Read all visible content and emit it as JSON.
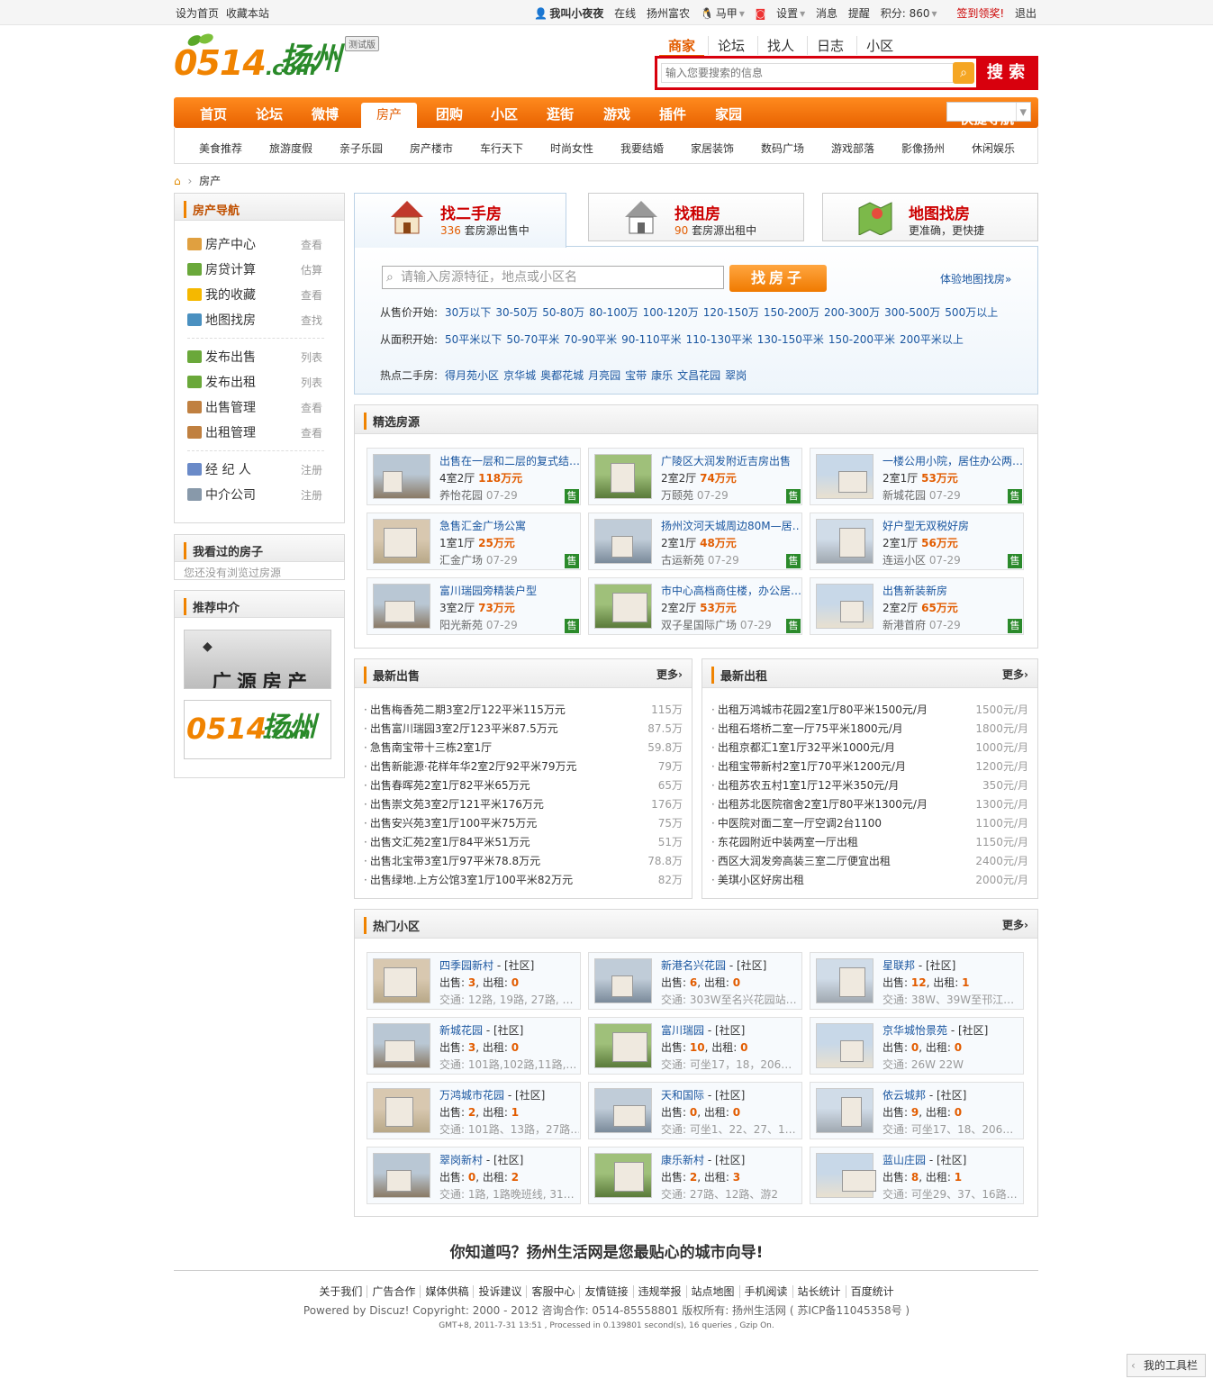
{
  "topbar": {
    "set_home": "设为首页",
    "bookmark": "收藏本站",
    "user": "我叫小夜夜",
    "online": "在线",
    "group": "扬州富农",
    "qq": "马甲",
    "settings": "设置",
    "messages": "消息",
    "remind": "提醒",
    "points": "积分: 860",
    "sign": "签到领奖!",
    "logout": "退出"
  },
  "logo": {
    "num": "0514",
    "dotcom": ".com",
    "city": "扬州",
    "beta": "测试版"
  },
  "search": {
    "tabs": [
      "商家",
      "论坛",
      "找人",
      "日志",
      "小区"
    ],
    "placeholder": "输入您要搜索的信息",
    "button": "搜 索"
  },
  "nav": {
    "items": [
      "首页",
      "论坛",
      "微博",
      "房产",
      "团购",
      "小区",
      "逛街",
      "游戏",
      "插件",
      "家园"
    ],
    "active": "房产",
    "quick": "快捷导航"
  },
  "subnav": [
    "美食推荐",
    "旅游度假",
    "亲子乐园",
    "房产楼市",
    "车行天下",
    "时尚女性",
    "我要结婚",
    "家居装饰",
    "数码广场",
    "游戏部落",
    "影像扬州",
    "休闲娱乐"
  ],
  "crumb": "房产",
  "left": {
    "nav_title": "房产导航",
    "nav_items": [
      {
        "label": "房产中心",
        "action": "查看",
        "color": "#e0a040"
      },
      {
        "label": "房贷计算",
        "action": "估算",
        "color": "#6aa83a"
      },
      {
        "label": "我的收藏",
        "action": "查看",
        "color": "#f5b800"
      },
      {
        "label": "地图找房",
        "action": "查找",
        "color": "#4a90c0"
      },
      {
        "label": "发布出售",
        "action": "列表",
        "color": "#6aa83a"
      },
      {
        "label": "发布出租",
        "action": "列表",
        "color": "#6aa83a"
      },
      {
        "label": "出售管理",
        "action": "查看",
        "color": "#c08040"
      },
      {
        "label": "出租管理",
        "action": "查看",
        "color": "#c08040"
      },
      {
        "label": "经 纪 人",
        "action": "注册",
        "color": "#6a8ac8"
      },
      {
        "label": "中介公司",
        "action": "注册",
        "color": "#8899aa"
      }
    ],
    "viewed_title": "我看过的房子",
    "viewed_empty": "您还没有浏览过房源",
    "agent_title": "推荐中介",
    "agent1": "广源房产",
    "agent2_num": "0514",
    "agent2_city": "扬州",
    "agent2_com": ".com"
  },
  "tabs": [
    {
      "title": "找二手房",
      "count": "336",
      "suffix": "套房源出售中"
    },
    {
      "title": "找租房",
      "count": "90",
      "suffix": "套房源出租中"
    },
    {
      "title": "地图找房",
      "count": "",
      "suffix": "更准确，更快捷"
    }
  ],
  "spanel": {
    "placeholder": "请输入房源特征，地点或小区名",
    "button": "找房子",
    "map_link": "体验地图找房»",
    "price_label": "从售价开始:",
    "prices": [
      "30万以下",
      "30-50万",
      "50-80万",
      "80-100万",
      "100-120万",
      "120-150万",
      "150-200万",
      "200-300万",
      "300-500万",
      "500万以上"
    ],
    "area_label": "从面积开始:",
    "areas": [
      "50平米以下",
      "50-70平米",
      "70-90平米",
      "90-110平米",
      "110-130平米",
      "130-150平米",
      "150-200平米",
      "200平米以上"
    ],
    "hot_label": "热点二手房:",
    "hots": [
      "得月苑小区",
      "京华城",
      "奥都花城",
      "月亮园",
      "宝带",
      "康乐",
      "文昌花园",
      "翠岗"
    ]
  },
  "featured": {
    "title": "精选房源",
    "sale_tag": "售",
    "items": [
      {
        "title": "出售在一层和二层的复式结…",
        "rooms": "4室2厅",
        "price": "118万元",
        "area": "养怡花园",
        "date": "07-29"
      },
      {
        "title": "广陵区大润发附近吉房出售",
        "rooms": "2室2厅",
        "price": "74万元",
        "area": "万颐苑",
        "date": "07-29"
      },
      {
        "title": "一楼公用小院，居住办公两…",
        "rooms": "2室1厅",
        "price": "53万元",
        "area": "新城花园",
        "date": "07-29"
      },
      {
        "title": "急售汇金广场公寓",
        "rooms": "1室1厅",
        "price": "25万元",
        "area": "汇金广场",
        "date": "07-29"
      },
      {
        "title": "扬州汶河天城周边80M—居…",
        "rooms": "2室1厅",
        "price": "48万元",
        "area": "古运新苑",
        "date": "07-29"
      },
      {
        "title": "好户型无双税好房",
        "rooms": "2室1厅",
        "price": "56万元",
        "area": "连运小区",
        "date": "07-29"
      },
      {
        "title": "富川瑞园旁精装户型",
        "rooms": "3室2厅",
        "price": "73万元",
        "area": "阳光新苑",
        "date": "07-29"
      },
      {
        "title": "市中心高档商住楼，办公居…",
        "rooms": "2室2厅",
        "price": "53万元",
        "area": "双子星国际广场",
        "date": "07-29"
      },
      {
        "title": "出售新装新房",
        "rooms": "2室2厅",
        "price": "65万元",
        "area": "新港首府",
        "date": "07-29"
      }
    ]
  },
  "latest_sale": {
    "title": "最新出售",
    "more": "更多›",
    "items": [
      {
        "t": "出售梅香苑二期3室2厅122平米115万元",
        "p": "115万"
      },
      {
        "t": "出售富川瑞园3室2厅123平米87.5万元",
        "p": "87.5万"
      },
      {
        "t": "急售南宝带十三栋2室1厅",
        "p": "59.8万"
      },
      {
        "t": "出售新能源·花样年华2室2厅92平米79万元",
        "p": "79万"
      },
      {
        "t": "出售春晖苑2室1厅82平米65万元",
        "p": "65万"
      },
      {
        "t": "出售崇文苑3室2厅121平米176万元",
        "p": "176万"
      },
      {
        "t": "出售安兴苑3室1厅100平米75万元",
        "p": "75万"
      },
      {
        "t": "出售文汇苑2室1厅84平米51万元",
        "p": "51万"
      },
      {
        "t": "出售北宝带3室1厅97平米78.8万元",
        "p": "78.8万"
      },
      {
        "t": "出售绿地.上方公馆3室1厅100平米82万元",
        "p": "82万"
      }
    ]
  },
  "latest_rent": {
    "title": "最新出租",
    "more": "更多›",
    "items": [
      {
        "t": "出租万鸿城市花园2室1厅80平米1500元/月",
        "p": "1500元/月"
      },
      {
        "t": "出租石塔桥二室一厅75平米1800元/月",
        "p": "1800元/月"
      },
      {
        "t": "出租京都汇1室1厅32平米1000元/月",
        "p": "1000元/月"
      },
      {
        "t": "出租宝带新村2室1厅70平米1200元/月",
        "p": "1200元/月"
      },
      {
        "t": "出租苏农五村1室1厅12平米350元/月",
        "p": "350元/月"
      },
      {
        "t": "出租苏北医院宿舍2室1厅80平米1300元/月",
        "p": "1300元/月"
      },
      {
        "t": "中医院对面二室一厅空调2台1100",
        "p": "1100元/月"
      },
      {
        "t": "东花园附近中装两室一厅出租",
        "p": "1150元/月"
      },
      {
        "t": "西区大润发旁高装三室二厅便宜出租",
        "p": "2400元/月"
      },
      {
        "t": "美琪小区好房出租",
        "p": "2000元/月"
      }
    ]
  },
  "hot_communities": {
    "title": "热门小区",
    "more": "更多›",
    "tag": "- [社区]",
    "sale_label": "出售: ",
    "rent_label": ", 出租: ",
    "traffic_label": "交通: ",
    "items": [
      {
        "name": "四季园新村",
        "sale": "3",
        "rent": "0",
        "traffic": "12路, 19路, 27路, …"
      },
      {
        "name": "新港名兴花园",
        "sale": "6",
        "rent": "0",
        "traffic": "303W至名兴花园站…"
      },
      {
        "name": "星联邦",
        "sale": "12",
        "rent": "1",
        "traffic": "38W、39W至邗江…"
      },
      {
        "name": "新城花园",
        "sale": "3",
        "rent": "0",
        "traffic": "101路,102路,11路,…"
      },
      {
        "name": "富川瑞园",
        "sale": "10",
        "rent": "0",
        "traffic": "可坐17，18，206…"
      },
      {
        "name": "京华城怡景苑",
        "sale": "0",
        "rent": "0",
        "traffic": "26W 22W"
      },
      {
        "name": "万鸿城市花园",
        "sale": "2",
        "rent": "1",
        "traffic": "101路、13路，27路…"
      },
      {
        "name": "天和国际",
        "sale": "0",
        "rent": "0",
        "traffic": "可坐1、22、27、1…"
      },
      {
        "name": "依云城邦",
        "sale": "9",
        "rent": "0",
        "traffic": "可坐17、18、206…"
      },
      {
        "name": "翠岗新村",
        "sale": "0",
        "rent": "2",
        "traffic": "1路, 1路晚班线, 31…"
      },
      {
        "name": "康乐新村",
        "sale": "2",
        "rent": "3",
        "traffic": "27路、12路、游2"
      },
      {
        "name": "蓝山庄园",
        "sale": "8",
        "rent": "1",
        "traffic": "可坐29、37、16路…"
      }
    ]
  },
  "footer": {
    "question": "你知道吗？扬州生活网是您最贴心的城市向导!",
    "links": [
      "关于我们",
      "广告合作",
      "媒体供稿",
      "投诉建议",
      "客服中心",
      "友情链接",
      "违规举报",
      "站点地图",
      "手机阅读",
      "站长统计",
      "百度统计"
    ],
    "copyright": "Powered by Discuz! Copyright: 2000 - 2012    咨询合作: 0514-85558801 版权所有: 扬州生活网 ( 苏ICP备11045358号 )",
    "gmt": "GMT+8, 2011-7-31 13:51 , Processed in 0.139801 second(s), 16 queries , Gzip On.",
    "toolbar": "我的工具栏"
  }
}
